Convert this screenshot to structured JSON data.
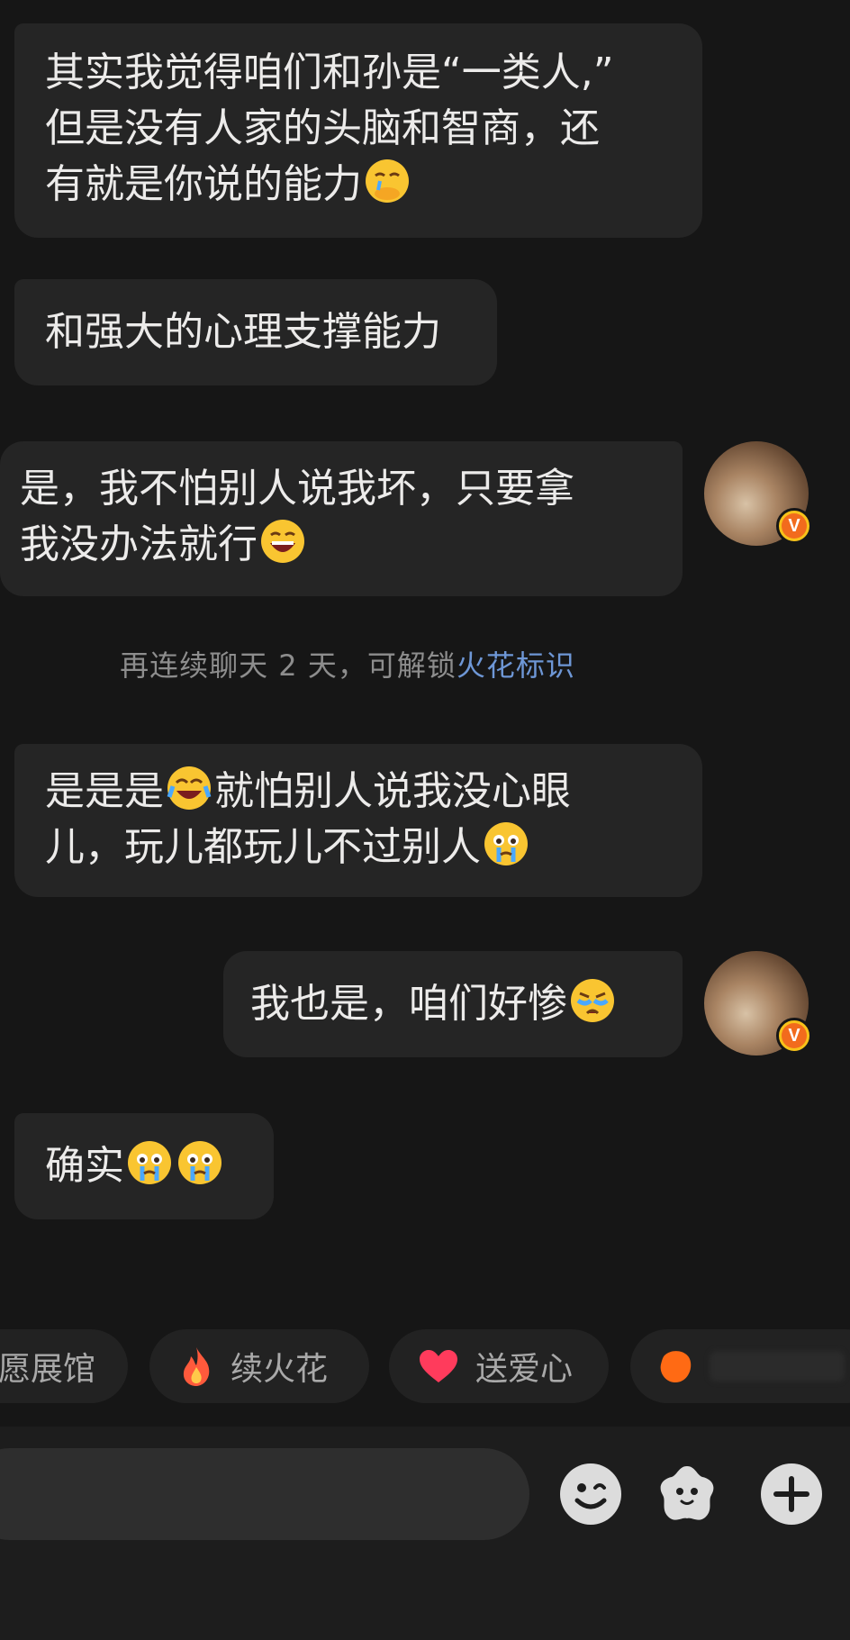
{
  "messages": [
    {
      "side": "left",
      "lines": [
        "其实我觉得咱们和孙是“一类人,”",
        "但是没有人家的头脑和智商，还",
        "有就是你说的能力"
      ],
      "trailing_emoji": "covering-mouth-emoji"
    },
    {
      "side": "left",
      "lines": [
        "和强大的心理支撑能力"
      ]
    },
    {
      "side": "right",
      "lines": [
        "是，我不怕别人说我坏，只要拿",
        "我没办法就行"
      ],
      "trailing_emoji": "grin-emoji"
    },
    {
      "side": "left",
      "parts": [
        "是是是",
        "就怕别人说我没心眼",
        "儿，玩儿都玩儿不过别人"
      ],
      "emojis": [
        "laugh-cry-emoji",
        "crying-emoji"
      ]
    },
    {
      "side": "right",
      "lines": [
        "我也是，咱们好惨"
      ],
      "trailing_emoji": "sobbing-emoji"
    },
    {
      "side": "left",
      "lines": [
        "确实"
      ],
      "trailing_emoji": "crying-emoji x2"
    }
  ],
  "notice": {
    "text": "再连续聊天 2 天，可解锁",
    "link": "火花标识"
  },
  "chips": [
    {
      "label": "愿展馆",
      "icon": ""
    },
    {
      "label": "续火花",
      "icon": "fire-icon"
    },
    {
      "label": "送爱心",
      "icon": "heart-icon"
    }
  ],
  "input": {
    "placeholder": ""
  },
  "buttons": {
    "emoji": "smiley-icon",
    "sticker": "sticker-icon",
    "more": "plus-icon"
  },
  "colors": {
    "background": "#161616",
    "bubble": "#252525",
    "link": "#6e97d6",
    "badge": "#f7c21a"
  }
}
